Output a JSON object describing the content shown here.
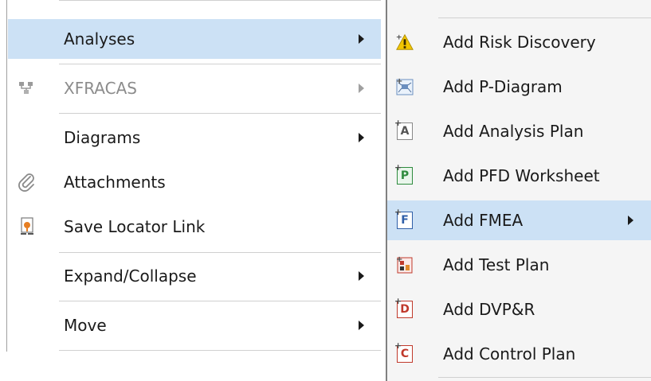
{
  "main_menu": {
    "items": [
      {
        "label": "Analyses",
        "icon": "analyses-icon",
        "has_submenu": true,
        "highlighted": true,
        "enabled": true
      },
      {
        "label": "XFRACAS",
        "icon": "xfracas-network-icon",
        "has_submenu": true,
        "enabled": false
      },
      {
        "label": "Diagrams",
        "icon": "",
        "has_submenu": true,
        "enabled": true
      },
      {
        "label": "Attachments",
        "icon": "paperclip-icon",
        "has_submenu": false,
        "enabled": true
      },
      {
        "label": "Save Locator Link",
        "icon": "locator-link-icon",
        "has_submenu": false,
        "enabled": true
      },
      {
        "label": "Expand/Collapse",
        "icon": "",
        "has_submenu": true,
        "enabled": true
      },
      {
        "label": "Move",
        "icon": "",
        "has_submenu": true,
        "enabled": true
      }
    ]
  },
  "sub_menu": {
    "items": [
      {
        "label": "Add Risk Discovery",
        "icon": "risk-discovery-icon",
        "glyph": "!"
      },
      {
        "label": "Add P-Diagram",
        "icon": "p-diagram-icon",
        "glyph": ""
      },
      {
        "label": "Add Analysis Plan",
        "icon": "analysis-plan-icon",
        "glyph": "A"
      },
      {
        "label": "Add PFD Worksheet",
        "icon": "pfd-worksheet-icon",
        "glyph": "P"
      },
      {
        "label": "Add FMEA",
        "icon": "fmea-icon",
        "glyph": "F",
        "has_submenu": true,
        "highlighted": true
      },
      {
        "label": "Add Test Plan",
        "icon": "test-plan-icon",
        "glyph": ""
      },
      {
        "label": "Add DVP&R",
        "icon": "dvpr-icon",
        "glyph": "D"
      },
      {
        "label": "Add Control Plan",
        "icon": "control-plan-icon",
        "glyph": "C"
      }
    ]
  },
  "colors": {
    "highlight": "#cce1f5",
    "disabled_text": "#8c8c8c",
    "risk_yellow": "#f2c500",
    "pfd_green": "#2e8b3d",
    "fmea_blue": "#2f5fa8",
    "dvpr_red": "#c0392b"
  }
}
